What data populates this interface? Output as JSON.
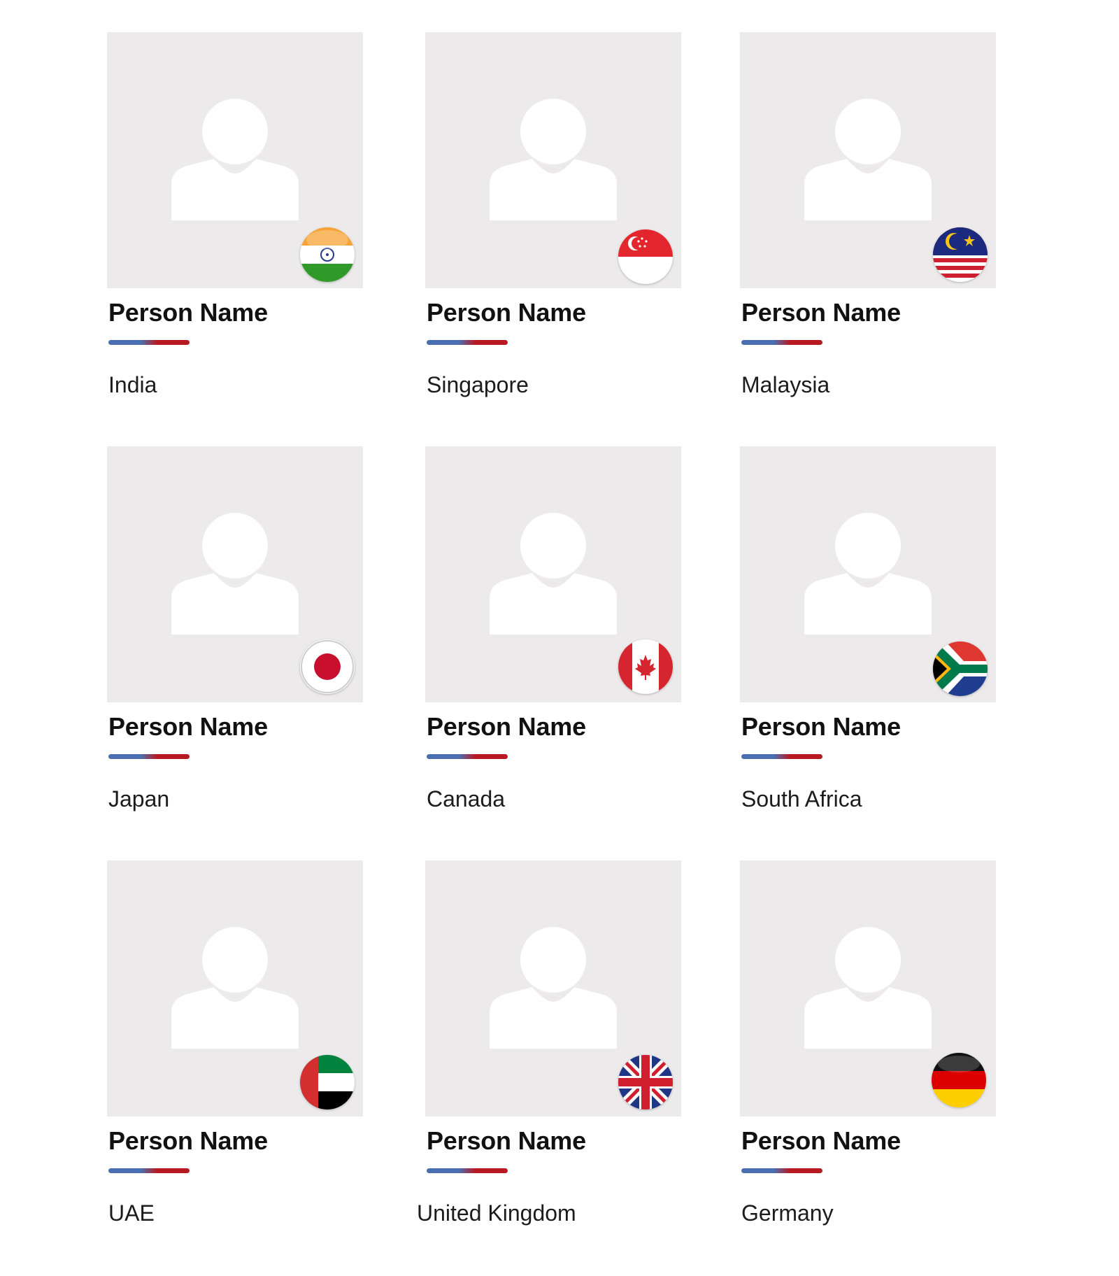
{
  "team": [
    {
      "name": "Person Name",
      "country": "India",
      "flag_icon": "india-flag-icon"
    },
    {
      "name": "Person Name",
      "country": "Singapore",
      "flag_icon": "singapore-flag-icon"
    },
    {
      "name": "Person Name",
      "country": "Malaysia",
      "flag_icon": "malaysia-flag-icon"
    },
    {
      "name": "Person Name",
      "country": "Japan",
      "flag_icon": "japan-flag-icon"
    },
    {
      "name": "Person Name",
      "country": "Canada",
      "flag_icon": "canada-flag-icon"
    },
    {
      "name": "Person Name",
      "country": "South Africa",
      "flag_icon": "south-africa-flag-icon"
    },
    {
      "name": "Person Name",
      "country": "UAE",
      "flag_icon": "uae-flag-icon"
    },
    {
      "name": "Person Name",
      "country": "United Kingdom",
      "flag_icon": "united-kingdom-flag-icon"
    },
    {
      "name": "Person Name",
      "country": "Germany",
      "flag_icon": "germany-flag-icon"
    }
  ],
  "colors": {
    "photo_background": "#eceaeb",
    "divider_blue": "#4a6fb0",
    "divider_red": "#b81a22",
    "name_text": "#111111",
    "country_text": "#1c1c1c"
  }
}
